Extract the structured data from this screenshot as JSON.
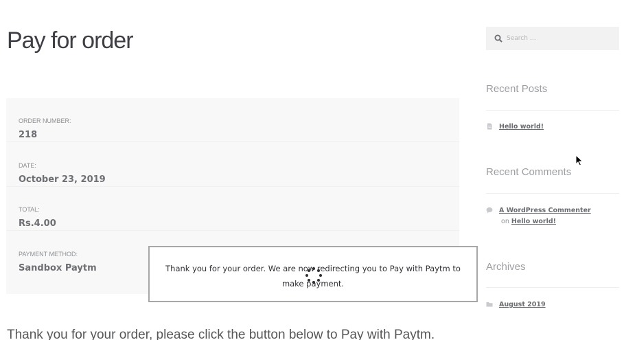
{
  "main": {
    "page_title": "Pay for order",
    "order_details": [
      {
        "label": "ORDER NUMBER:",
        "value": "218"
      },
      {
        "label": "DATE:",
        "value": "October 23, 2019"
      },
      {
        "label": "TOTAL:",
        "value": "Rs.4.00"
      },
      {
        "label": "PAYMENT METHOD:",
        "value": "Sandbox Paytm"
      }
    ],
    "thankyou_text": "Thank you for your order, please click the button below to Pay with Paytm."
  },
  "modal": {
    "message": "Thank you for your order. We are now redirecting you to Pay with Paytm to make payment.",
    "spinner_icon": "loading-spinner-icon"
  },
  "sidebar": {
    "search": {
      "placeholder": "Search …",
      "value": "",
      "icon": "search-icon"
    },
    "recent_posts": {
      "title": "Recent Posts",
      "items": [
        {
          "label": "Hello world!",
          "icon": "document-icon"
        }
      ]
    },
    "recent_comments": {
      "title": "Recent Comments",
      "items": [
        {
          "author": "A WordPress Commenter",
          "connector": " on ",
          "post": "Hello world!",
          "icon": "comment-icon"
        }
      ]
    },
    "archives": {
      "title": "Archives",
      "items": [
        {
          "label": "August 2019",
          "icon": "folder-icon"
        }
      ]
    }
  },
  "colors": {
    "background": "#ffffff",
    "order_box": "#f8f8f8",
    "modal_border": "#a7a7a7",
    "search_bg": "#f2f2f2"
  }
}
